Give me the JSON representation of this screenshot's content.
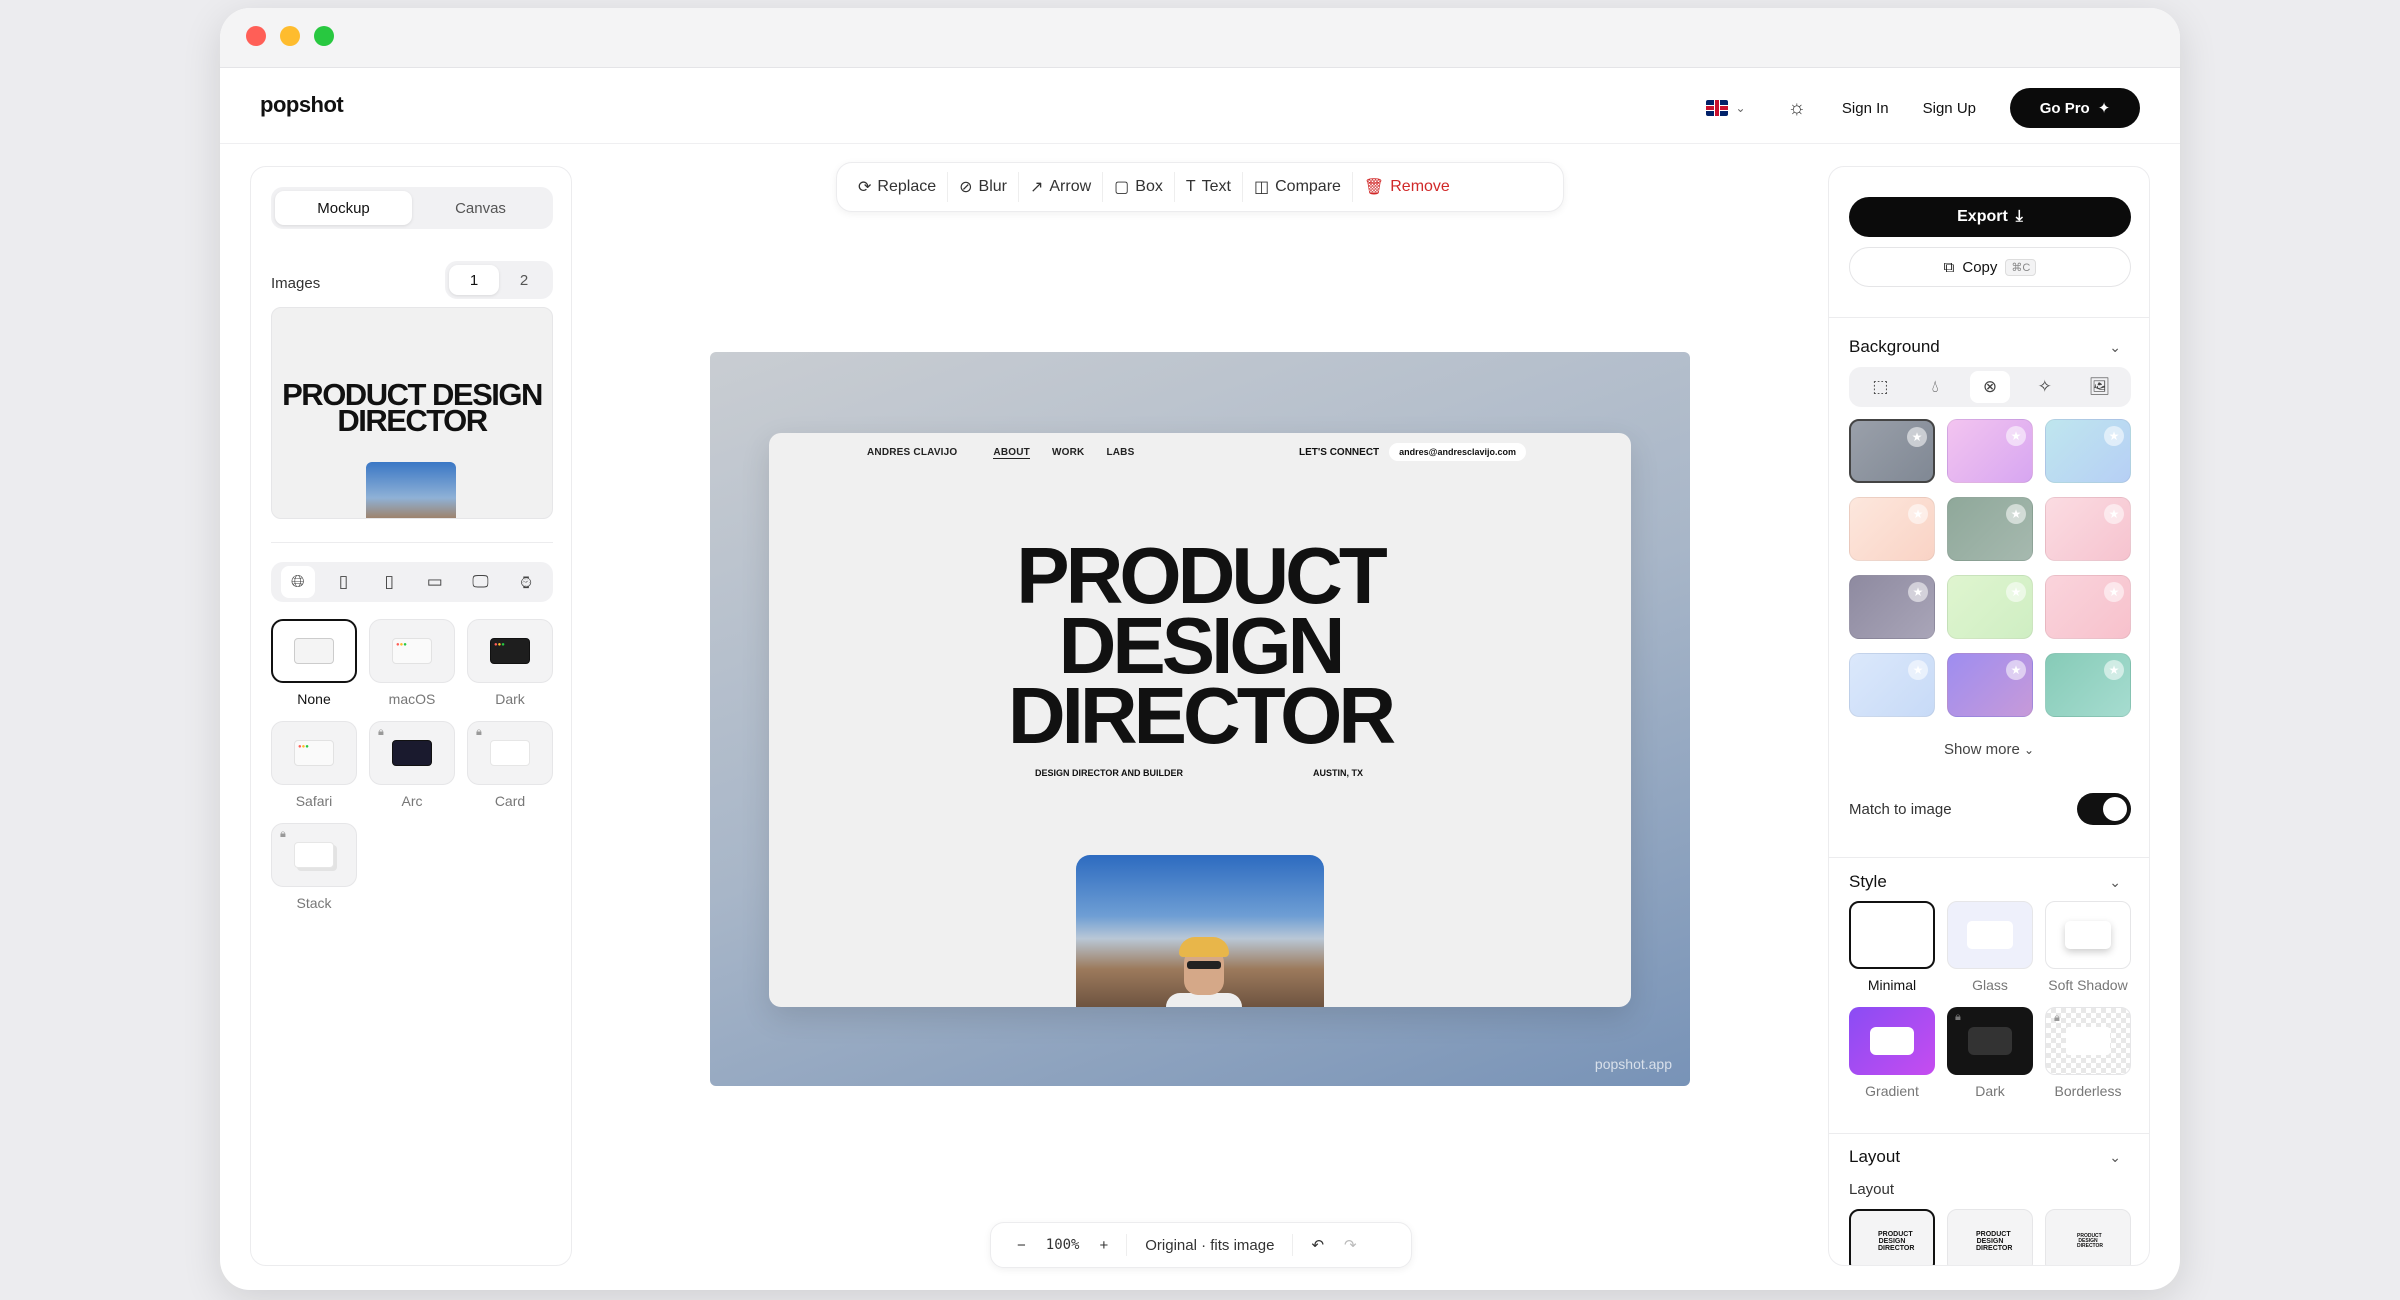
{
  "app": {
    "logo": "popshot"
  },
  "nav": {
    "sign_in": "Sign In",
    "sign_up": "Sign Up",
    "go_pro": "Go Pro"
  },
  "left": {
    "tabs": [
      "Mockup",
      "Canvas"
    ],
    "images_label": "Images",
    "image_pages": [
      "1",
      "2"
    ],
    "thumb_title": "PRODUCT DESIGN DIRECTOR",
    "frames": [
      {
        "label": "None",
        "locked": false
      },
      {
        "label": "macOS",
        "locked": false
      },
      {
        "label": "Dark",
        "locked": false
      },
      {
        "label": "Safari",
        "locked": false
      },
      {
        "label": "Arc",
        "locked": true
      },
      {
        "label": "Card",
        "locked": true
      },
      {
        "label": "Stack",
        "locked": true
      }
    ]
  },
  "toolbar": {
    "replace": "Replace",
    "blur": "Blur",
    "arrow": "Arrow",
    "box": "Box",
    "text": "Text",
    "compare": "Compare",
    "remove": "Remove"
  },
  "canvas": {
    "watermark": "popshot.app",
    "site": {
      "name": "ANDRES CLAVIJO",
      "links": [
        "ABOUT",
        "WORK",
        "LABS"
      ],
      "connect": "LET'S CONNECT",
      "email": "andres@andresclavijo.com",
      "hero_line1": "PRODUCT",
      "hero_line2": "DESIGN",
      "hero_line3": "DIRECTOR",
      "sub_left": "DESIGN DIRECTOR AND BUILDER",
      "sub_right": "AUSTIN, TX"
    }
  },
  "zoom": {
    "minus": "−",
    "value": "100%",
    "plus": "+",
    "mode": "Original · fits image"
  },
  "right": {
    "export": "Export",
    "copy": "Copy",
    "copy_shortcut": "⌘C",
    "background": "Background",
    "show_more": "Show more",
    "match_to_image": "Match to image",
    "style": "Style",
    "styles": [
      "Minimal",
      "Glass",
      "Soft Shadow",
      "Gradient",
      "Dark",
      "Borderless"
    ],
    "layout": "Layout",
    "layout_sub": "Layout"
  }
}
